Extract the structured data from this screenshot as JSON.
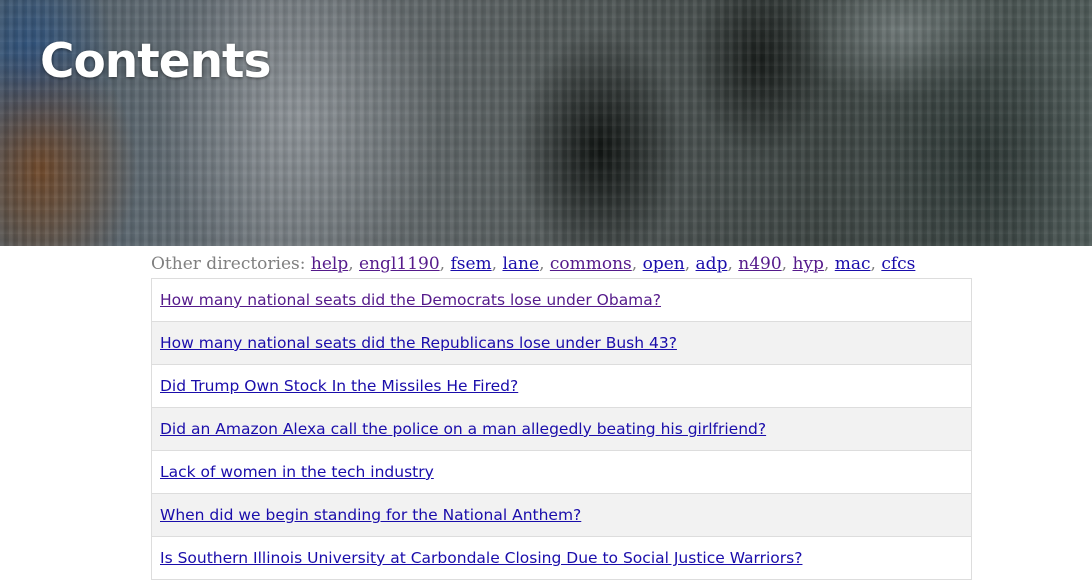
{
  "header": {
    "title": "Contents"
  },
  "directories": {
    "label": "Other directories:",
    "links": [
      {
        "label": "help",
        "visited": true
      },
      {
        "label": "engl1190",
        "visited": true
      },
      {
        "label": "fsem",
        "visited": false
      },
      {
        "label": "lane",
        "visited": false
      },
      {
        "label": "commons",
        "visited": true
      },
      {
        "label": "open",
        "visited": false
      },
      {
        "label": "adp",
        "visited": false
      },
      {
        "label": "n490",
        "visited": true
      },
      {
        "label": "hyp",
        "visited": true
      },
      {
        "label": "mac",
        "visited": false
      },
      {
        "label": "cfcs",
        "visited": false
      }
    ]
  },
  "articles": [
    {
      "title": "How many national seats did the Democrats lose under Obama?",
      "visited": true
    },
    {
      "title": "How many national seats did the Republicans lose under Bush 43?",
      "visited": false
    },
    {
      "title": "Did Trump Own Stock In the Missiles He Fired?",
      "visited": false
    },
    {
      "title": "Did an Amazon Alexa call the police on a man allegedly beating his girlfriend?",
      "visited": false
    },
    {
      "title": "Lack of women in the tech industry",
      "visited": false
    },
    {
      "title": "When did we begin standing for the National Anthem?",
      "visited": false
    },
    {
      "title": "Is Southern Illinois University at Carbondale Closing Due to Social Justice Warriors?",
      "visited": false
    }
  ],
  "colors": {
    "link": "#1a0dab",
    "visited_link": "#551a8b",
    "label_gray": "#808080",
    "row_alt": "#f2f2f2",
    "border": "#dddddd"
  }
}
